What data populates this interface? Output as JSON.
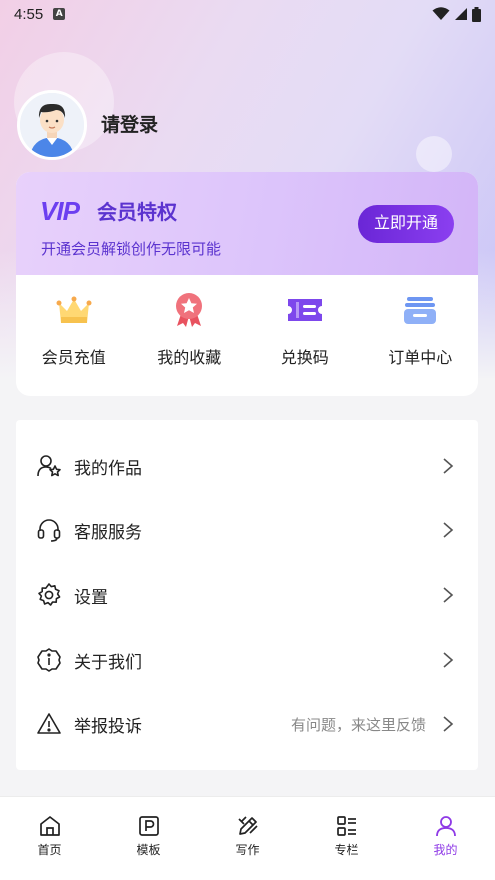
{
  "status_bar": {
    "time": "4:55",
    "notification_letter": "A"
  },
  "profile": {
    "login_text": "请登录"
  },
  "vip": {
    "logo_text": "VIP",
    "title": "会员特权",
    "subtitle": "开通会员解锁创作无限可能",
    "cta_label": "立即开通"
  },
  "shortcuts": [
    {
      "label": "会员充值",
      "icon": "crown-icon"
    },
    {
      "label": "我的收藏",
      "icon": "medal-icon"
    },
    {
      "label": "兑换码",
      "icon": "ticket-icon"
    },
    {
      "label": "订单中心",
      "icon": "order-stack-icon"
    }
  ],
  "menu": [
    {
      "label": "我的作品",
      "icon": "user-star-icon",
      "hint": ""
    },
    {
      "label": "客服服务",
      "icon": "headset-icon",
      "hint": ""
    },
    {
      "label": "设置",
      "icon": "gear-icon",
      "hint": ""
    },
    {
      "label": "关于我们",
      "icon": "info-icon",
      "hint": ""
    },
    {
      "label": "举报投诉",
      "icon": "warning-icon",
      "hint": "有问题，来这里反馈"
    }
  ],
  "bottom_nav": [
    {
      "label": "首页",
      "icon": "home-icon",
      "active": false
    },
    {
      "label": "模板",
      "icon": "template-icon",
      "active": false
    },
    {
      "label": "写作",
      "icon": "pencil-icon",
      "active": false
    },
    {
      "label": "专栏",
      "icon": "column-icon",
      "active": false
    },
    {
      "label": "我的",
      "icon": "user-icon",
      "active": true
    }
  ],
  "colors": {
    "accent": "#8e39e6",
    "vip_text": "#5b33cf",
    "cta_start": "#6a26d6",
    "cta_end": "#8b3ff0"
  }
}
